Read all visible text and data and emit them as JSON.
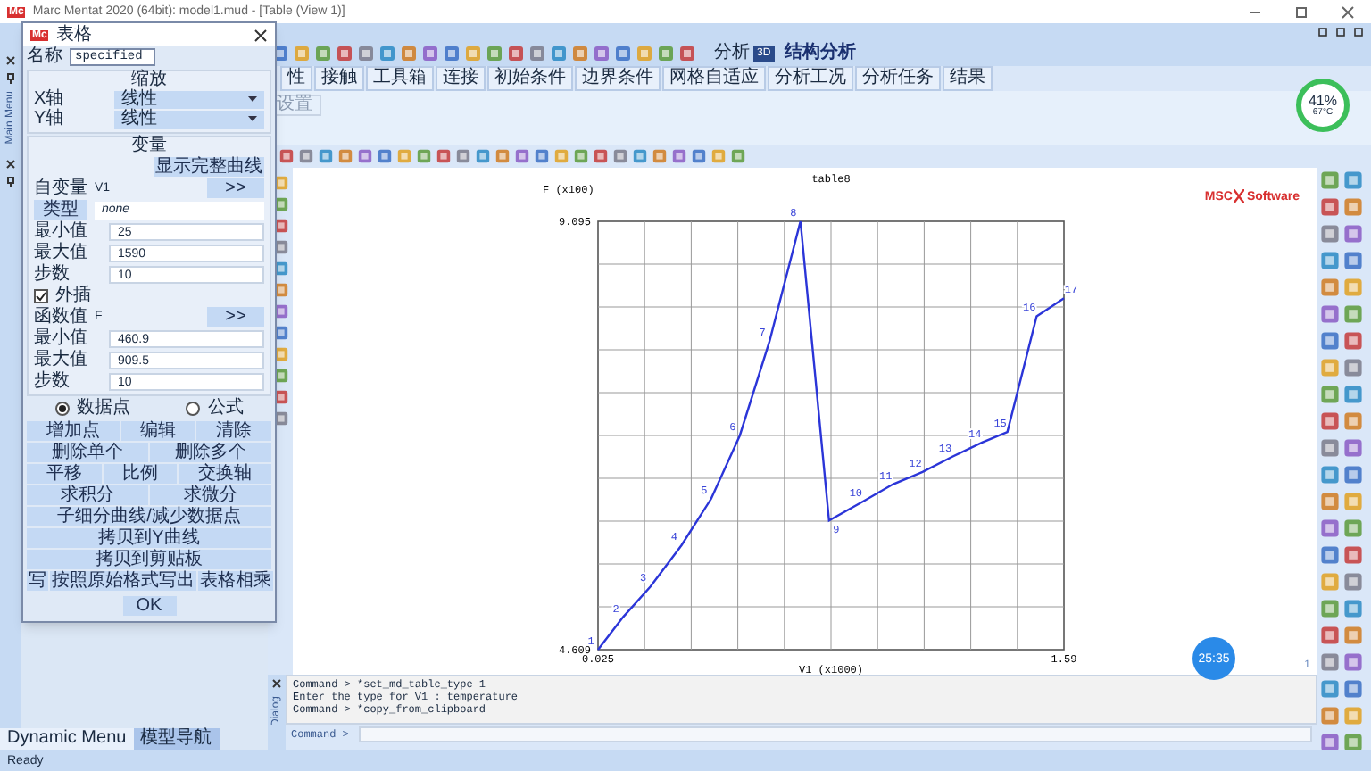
{
  "app": {
    "logo_text": "Mc",
    "title": "Marc Mentat 2020 (64bit): model1.mud - [Table (View 1)]"
  },
  "toolbar": {
    "analysis_label": "分析",
    "view_mode": "3D",
    "analysis_type": "结构分析"
  },
  "tabs": [
    {
      "label": "性",
      "selected": false
    },
    {
      "label": "接触",
      "selected": false
    },
    {
      "label": "工具箱",
      "selected": false
    },
    {
      "label": "连接",
      "selected": false
    },
    {
      "label": "初始条件",
      "selected": false
    },
    {
      "label": "边界条件",
      "selected": false
    },
    {
      "label": "网格自适应",
      "selected": false
    },
    {
      "label": "分析工况",
      "selected": false
    },
    {
      "label": "分析任务",
      "selected": false
    },
    {
      "label": "结果",
      "selected": false
    }
  ],
  "ribbon": {
    "button": "设置"
  },
  "perf_widget": {
    "usage": "41%",
    "temperature": "67°C"
  },
  "dialog": {
    "logo_text": "Mc",
    "title": "表格",
    "name_label": "名称",
    "name_value": "specified",
    "scale": {
      "heading": "缩放",
      "axes": [
        {
          "label": "X轴",
          "value": "线性"
        },
        {
          "label": "Y轴",
          "value": "线性"
        }
      ]
    },
    "variables": {
      "heading": "变量",
      "show_full": "显示完整曲线",
      "independent": {
        "label": "自变量",
        "name": "V1",
        "button": ">>",
        "type_label": "类型",
        "type_value": "none",
        "fields": [
          {
            "label": "最小值",
            "value": "25"
          },
          {
            "label": "最大值",
            "value": "1590"
          },
          {
            "label": "步数",
            "value": "10"
          }
        ],
        "extrapolate": {
          "label": "外插",
          "checked": true
        }
      },
      "function": {
        "label": "函数值",
        "name": "F",
        "button": ">>",
        "fields": [
          {
            "label": "最小值",
            "value": "460.9"
          },
          {
            "label": "最大值",
            "value": "909.5"
          },
          {
            "label": "步数",
            "value": "10"
          }
        ]
      }
    },
    "modes": [
      {
        "label": "数据点",
        "selected": true
      },
      {
        "label": "公式",
        "selected": false
      }
    ],
    "button_rows": [
      [
        "增加点",
        "编辑",
        "清除"
      ],
      [
        "删除单个",
        "删除多个"
      ],
      [
        "平移",
        "比例",
        "交换轴"
      ],
      [
        "求积分",
        "求微分"
      ],
      [
        "子细分曲线/减少数据点"
      ],
      [
        "拷贝到Y曲线"
      ],
      [
        "拷贝到剪贴板"
      ],
      [
        "写",
        "按照原始格式写出",
        "表格相乘"
      ]
    ],
    "ok": "OK"
  },
  "chart": {
    "chart_data": {
      "type": "line",
      "title": "table8",
      "xlabel": "V1 (x1000)",
      "ylabel": "F (x100)",
      "x": [
        0.025,
        0.109,
        0.201,
        0.305,
        0.405,
        0.501,
        0.601,
        0.705,
        0.801,
        0.915,
        1.015,
        1.115,
        1.215,
        1.315,
        1.4,
        1.498,
        1.59
      ],
      "series": [
        {
          "color": "#2b35d8",
          "values": [
            4.609,
            4.95,
            5.27,
            5.7,
            6.19,
            6.85,
            7.84,
            9.095,
            5.96,
            6.16,
            6.34,
            6.47,
            6.63,
            6.78,
            6.89,
            8.1,
            8.29
          ]
        }
      ],
      "xlim": [
        0.025,
        1.59
      ],
      "ylim": [
        4.609,
        9.095
      ],
      "xticks": [
        {
          "value": 0.025,
          "label": "0.025"
        },
        {
          "value": 1.59,
          "label": "1.59"
        }
      ],
      "yticks": [
        {
          "value": 4.609,
          "label": "4.609"
        },
        {
          "value": 9.095,
          "label": "9.095"
        }
      ],
      "value_labels": [
        "1",
        "2",
        "3",
        "4",
        "5",
        "6",
        "7",
        "8",
        "9",
        "10",
        "11",
        "12",
        "13",
        "14",
        "15",
        "16",
        "17"
      ]
    },
    "viewport_index": "1"
  },
  "logo": {
    "left": "MSC",
    "right": "Software"
  },
  "timer": "25:35",
  "side_panels": {
    "main_menu": "Main Menu",
    "dialog": "Dialog"
  },
  "command": {
    "lines": [
      "Command > *set_md_table_type 1",
      "Enter the type for V1 : temperature",
      "Command > *copy_from_clipboard"
    ],
    "prompt": "Command >"
  },
  "bottom_tabs": [
    {
      "label": "Dynamic Menu",
      "selected": false
    },
    {
      "label": "模型导航",
      "selected": true
    }
  ],
  "status": "Ready"
}
